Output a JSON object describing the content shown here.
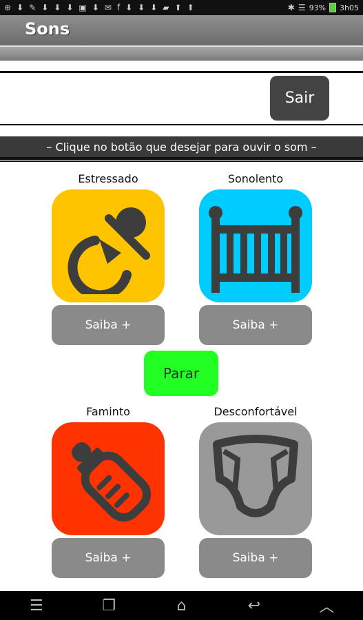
{
  "status_bar": {
    "battery": "93%",
    "time": "3h05"
  },
  "header": {
    "title": "Sons"
  },
  "exit_button": "Sair",
  "instruction": "– Clique no botão que desejar para ouvir o som –",
  "sounds": [
    {
      "label": "Estressado",
      "color": "#ffc400",
      "icon": "pacifier-icon",
      "more": "Saiba +"
    },
    {
      "label": "Sonolento",
      "color": "#00ccff",
      "icon": "crib-icon",
      "more": "Saiba +"
    },
    {
      "label": "Faminto",
      "color": "#ff3300",
      "icon": "baby-bottle-icon",
      "more": "Saiba +"
    },
    {
      "label": "Desconfortável",
      "color": "#999999",
      "icon": "diaper-icon",
      "more": "Saiba +"
    }
  ],
  "stop_button": "Parar"
}
